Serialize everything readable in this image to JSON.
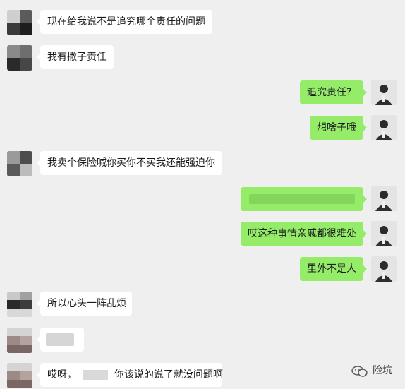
{
  "messages": [
    {
      "side": "left",
      "text": "现在给我说不是追究哪个责任的问题"
    },
    {
      "side": "left",
      "text": "我有撒子责任"
    },
    {
      "side": "right",
      "text": "追究责任?"
    },
    {
      "side": "right",
      "text": "想啥子哦"
    },
    {
      "side": "left",
      "text": "我卖个保险喊你买你不买我还能强迫你"
    },
    {
      "side": "right",
      "text": ""
    },
    {
      "side": "right",
      "text": "哎这种事情亲戚都很难处"
    },
    {
      "side": "right",
      "text": "里外不是人"
    },
    {
      "side": "left",
      "text": "所以心头一阵乱烦"
    },
    {
      "side": "left",
      "text": ""
    },
    {
      "side": "left",
      "text_part1": "哎呀，",
      "text_part2": "你该说的说了就没问题啊"
    }
  ],
  "watermark": {
    "text": "险坑",
    "icon": "wechat-official-account-icon"
  },
  "colors": {
    "background": "#efefef",
    "left_bubble": "#ffffff",
    "right_bubble": "#95ec69"
  }
}
